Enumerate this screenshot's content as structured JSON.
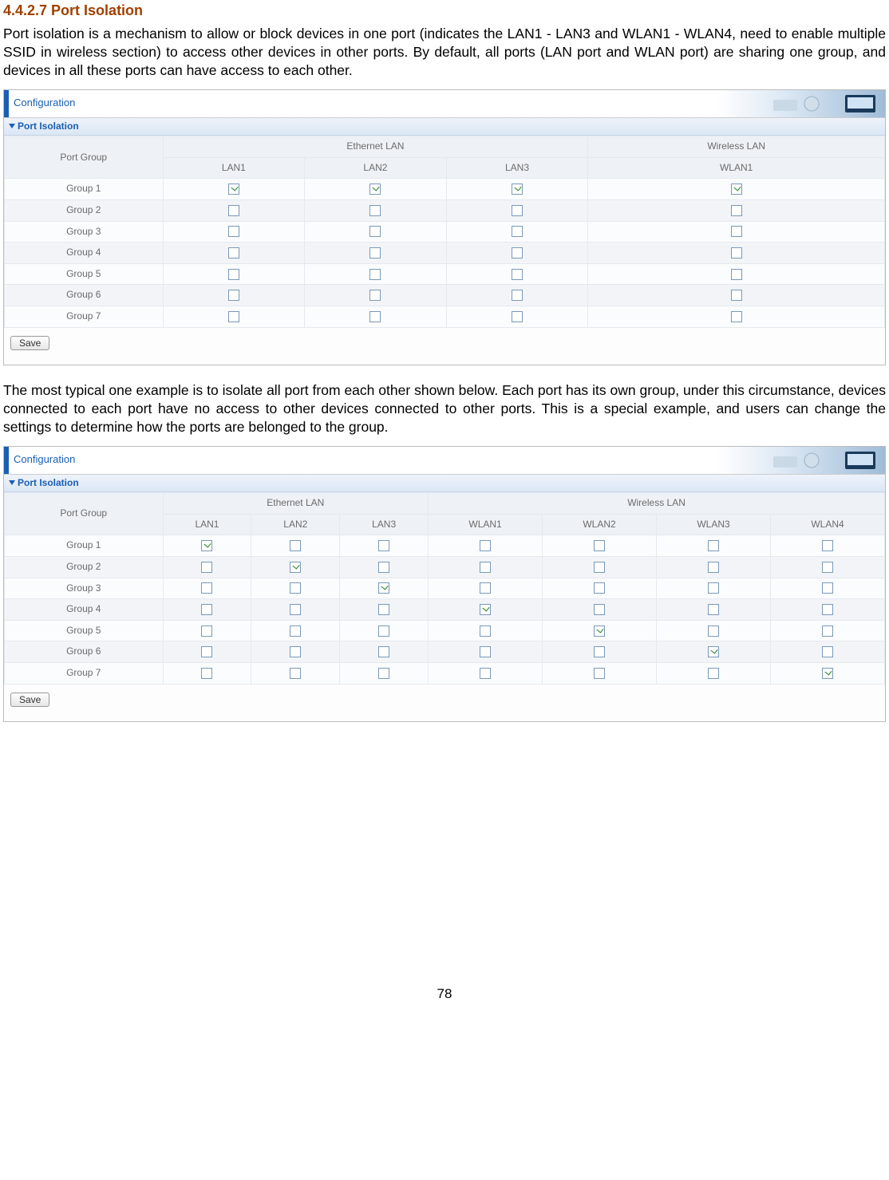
{
  "section_number_title": "4.4.2.7 Port Isolation",
  "para1": "Port isolation is a mechanism to allow or block devices in one port (indicates the LAN1 - LAN3 and WLAN1 - WLAN4, need to enable multiple SSID in wireless section) to access other devices in other ports. By default, all ports (LAN port and WLAN port) are sharing one group, and devices in all these ports can have access to each other.",
  "para2": "The most typical one example is to isolate all port from each other shown below. Each port has its own group, under this circumstance, devices connected to each port have no access to other devices connected to other ports. This is a special example, and users can change the settings to determine how the ports are belonged to the group.",
  "page_number": "78",
  "panel": {
    "config_title": "Configuration",
    "section_title": "Port Isolation",
    "save_label": "Save"
  },
  "table1": {
    "head_group": "Port Group",
    "head_eth": "Ethernet LAN",
    "head_wlan": "Wireless LAN",
    "cols": [
      "LAN1",
      "LAN2",
      "LAN3",
      "WLAN1"
    ],
    "rows": [
      {
        "label": "Group 1",
        "checks": [
          true,
          true,
          true,
          true
        ]
      },
      {
        "label": "Group 2",
        "checks": [
          false,
          false,
          false,
          false
        ]
      },
      {
        "label": "Group 3",
        "checks": [
          false,
          false,
          false,
          false
        ]
      },
      {
        "label": "Group 4",
        "checks": [
          false,
          false,
          false,
          false
        ]
      },
      {
        "label": "Group 5",
        "checks": [
          false,
          false,
          false,
          false
        ]
      },
      {
        "label": "Group 6",
        "checks": [
          false,
          false,
          false,
          false
        ]
      },
      {
        "label": "Group 7",
        "checks": [
          false,
          false,
          false,
          false
        ]
      }
    ]
  },
  "table2": {
    "head_group": "Port Group",
    "head_eth": "Ethernet LAN",
    "head_wlan": "Wireless LAN",
    "cols": [
      "LAN1",
      "LAN2",
      "LAN3",
      "WLAN1",
      "WLAN2",
      "WLAN3",
      "WLAN4"
    ],
    "rows": [
      {
        "label": "Group 1",
        "checks": [
          true,
          false,
          false,
          false,
          false,
          false,
          false
        ]
      },
      {
        "label": "Group 2",
        "checks": [
          false,
          true,
          false,
          false,
          false,
          false,
          false
        ]
      },
      {
        "label": "Group 3",
        "checks": [
          false,
          false,
          true,
          false,
          false,
          false,
          false
        ]
      },
      {
        "label": "Group 4",
        "checks": [
          false,
          false,
          false,
          true,
          false,
          false,
          false
        ]
      },
      {
        "label": "Group 5",
        "checks": [
          false,
          false,
          false,
          false,
          true,
          false,
          false
        ]
      },
      {
        "label": "Group 6",
        "checks": [
          false,
          false,
          false,
          false,
          false,
          true,
          false
        ]
      },
      {
        "label": "Group 7",
        "checks": [
          false,
          false,
          false,
          false,
          false,
          false,
          true
        ]
      }
    ]
  }
}
